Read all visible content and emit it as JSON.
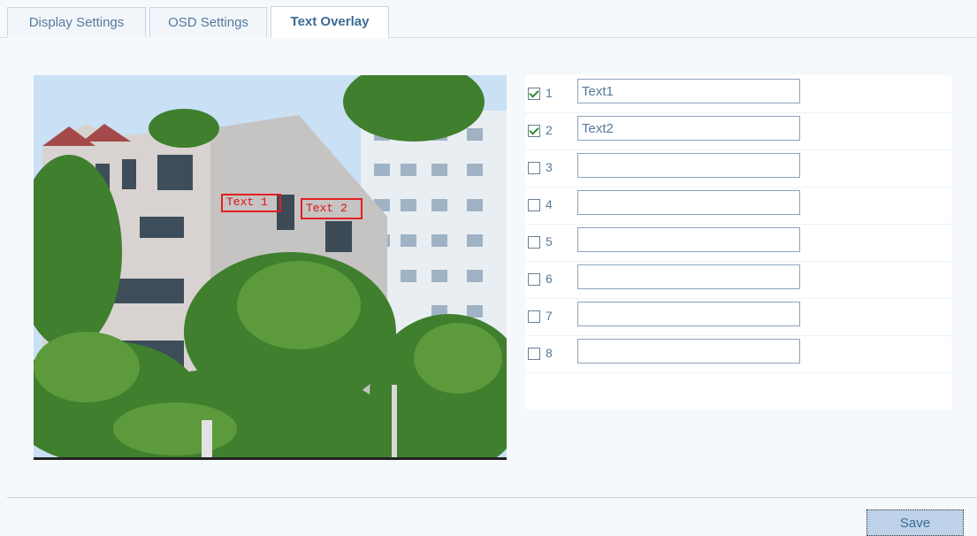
{
  "tabs": [
    {
      "label": "Display Settings",
      "active": false
    },
    {
      "label": "OSD Settings",
      "active": false
    },
    {
      "label": "Text Overlay",
      "active": true
    }
  ],
  "preview": {
    "overlays": [
      "Text 1",
      "Text 2"
    ]
  },
  "rows": [
    {
      "num": "1",
      "checked": true,
      "value": "Text1"
    },
    {
      "num": "2",
      "checked": true,
      "value": "Text2"
    },
    {
      "num": "3",
      "checked": false,
      "value": ""
    },
    {
      "num": "4",
      "checked": false,
      "value": ""
    },
    {
      "num": "5",
      "checked": false,
      "value": ""
    },
    {
      "num": "6",
      "checked": false,
      "value": ""
    },
    {
      "num": "7",
      "checked": false,
      "value": ""
    },
    {
      "num": "8",
      "checked": false,
      "value": ""
    }
  ],
  "save_label": "Save",
  "colors": {
    "accent": "#56799c",
    "overlay": "#e21f1f",
    "button": "#bdd2e8"
  }
}
